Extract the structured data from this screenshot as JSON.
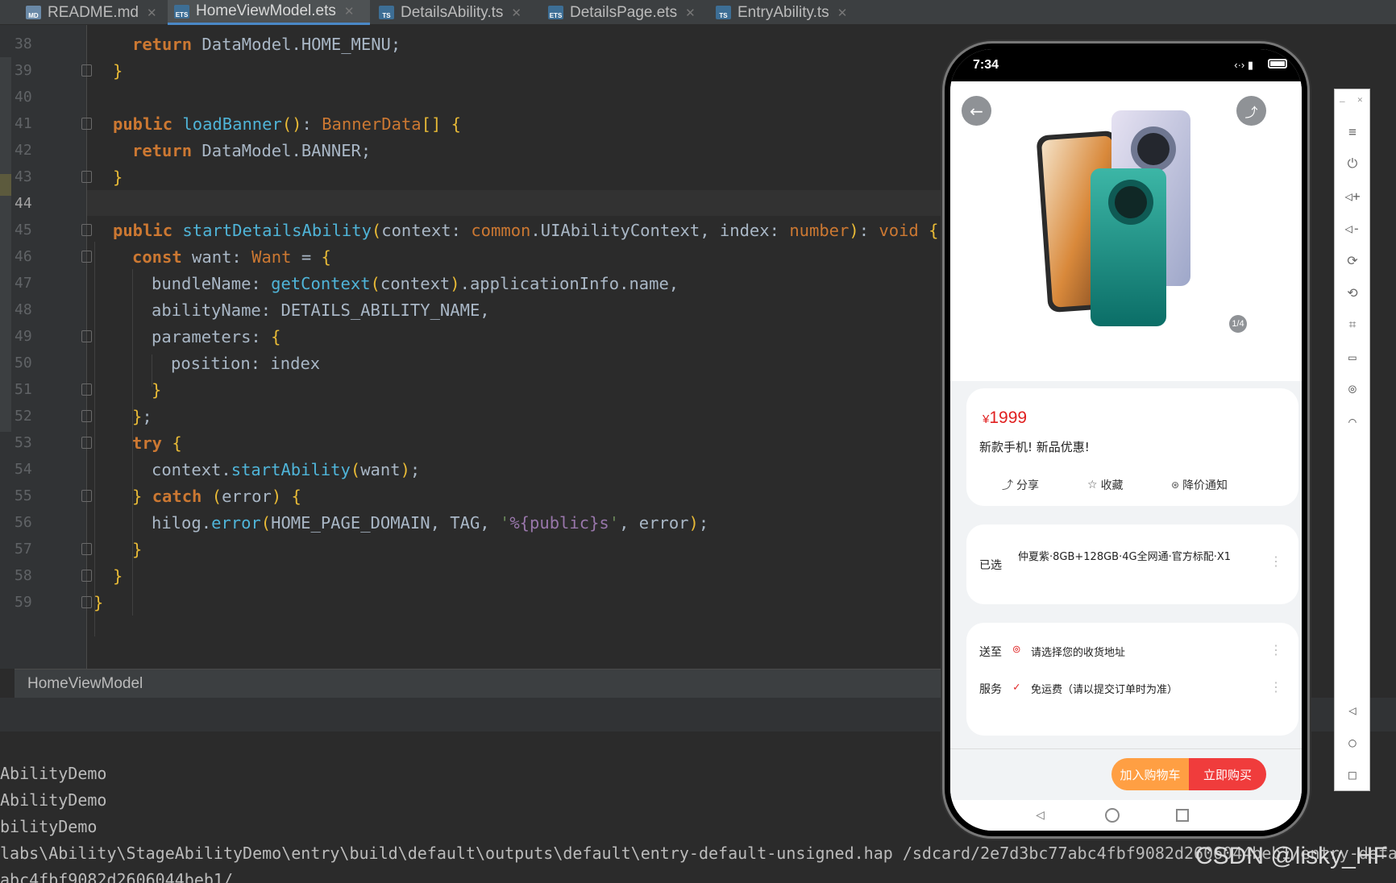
{
  "tabs": [
    {
      "name": "README.md",
      "icon": "MD"
    },
    {
      "name": "HomeViewModel.ets",
      "icon": "ETS"
    },
    {
      "name": "DetailsAbility.ts",
      "icon": "TS"
    },
    {
      "name": "DetailsPage.ets",
      "icon": "ETS"
    },
    {
      "name": "EntryAbility.ts",
      "icon": "TS"
    }
  ],
  "editor": {
    "line_numbers": [
      "38",
      "39",
      "40",
      "41",
      "42",
      "43",
      "44",
      "45",
      "46",
      "47",
      "48",
      "49",
      "50",
      "51",
      "52",
      "53",
      "54",
      "55",
      "56",
      "57",
      "58",
      "59"
    ],
    "current_line": "44",
    "breadcrumb": "HomeViewModel"
  },
  "console": {
    "lines": [
      "AbilityDemo",
      "AbilityDemo",
      "bilityDemo",
      "labs\\Ability\\StageAbilityDemo\\entry\\build\\default\\outputs\\default\\entry-default-unsigned.hap /sdcard/2e7d3bc77abc4fbf9082d2606044beb1/entry-defau",
      "abc4fbf9082d2606044beb1/"
    ]
  },
  "watermark": "CSDN @lisky_HF",
  "phone": {
    "time": "7:34",
    "page_indicator": "1/4",
    "price_currency": "¥",
    "price": "1999",
    "title": "新款手机!  新品优惠!",
    "actions": [
      "分享",
      "收藏",
      "降价通知"
    ],
    "selected_label": "已选",
    "selected_spec": "仲夏紫·8GB+128GB·4G全网通·官方标配·X1",
    "deliver_label": "送至",
    "deliver_value": "请选择您的收货地址",
    "service_label": "服务",
    "service_value": "免运费（请以提交订单时为准）",
    "add_cart": "加入购物车",
    "buy_now": "立即购买",
    "colors": {
      "price": "#e02020",
      "cart": "#ff9f43",
      "buy": "#f03c3c"
    }
  }
}
